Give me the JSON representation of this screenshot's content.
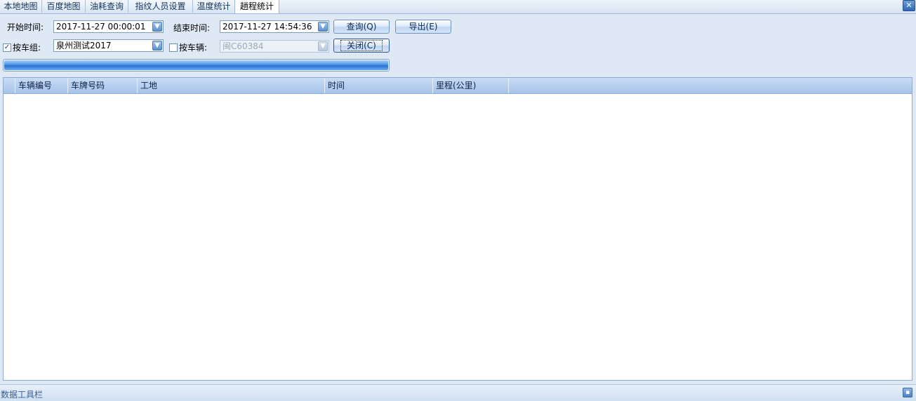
{
  "tabs": [
    {
      "label": "本地地图"
    },
    {
      "label": "百度地图"
    },
    {
      "label": "油耗查询"
    },
    {
      "label": "指纹人员设置"
    },
    {
      "label": "温度统计"
    },
    {
      "label": "趟程统计"
    }
  ],
  "active_tab": "趟程统计",
  "form": {
    "start_label": "开始时间:",
    "start_value": "2017-11-27 00:00:01",
    "end_label": "结束时间:",
    "end_value": "2017-11-27 14:54:36",
    "group_checkbox_label": "按车组:",
    "group_checked": true,
    "group_value": "泉州测试2017",
    "vehicle_checkbox_label": "按车辆:",
    "vehicle_checked": false,
    "vehicle_value": "闽C60384",
    "query_button": "查询(Q)",
    "export_button": "导出(E)",
    "close_button": "关闭(C)",
    "progress_percent": 100
  },
  "table": {
    "columns": [
      "车辆编号",
      "车牌号码",
      "工地",
      "时间",
      "里程(公里)"
    ],
    "rows": []
  },
  "statusbar": {
    "text": "数据工具栏"
  },
  "icons": {
    "close": "close-icon",
    "dropdown": "chevron-down-icon",
    "pin": "pin-icon"
  }
}
